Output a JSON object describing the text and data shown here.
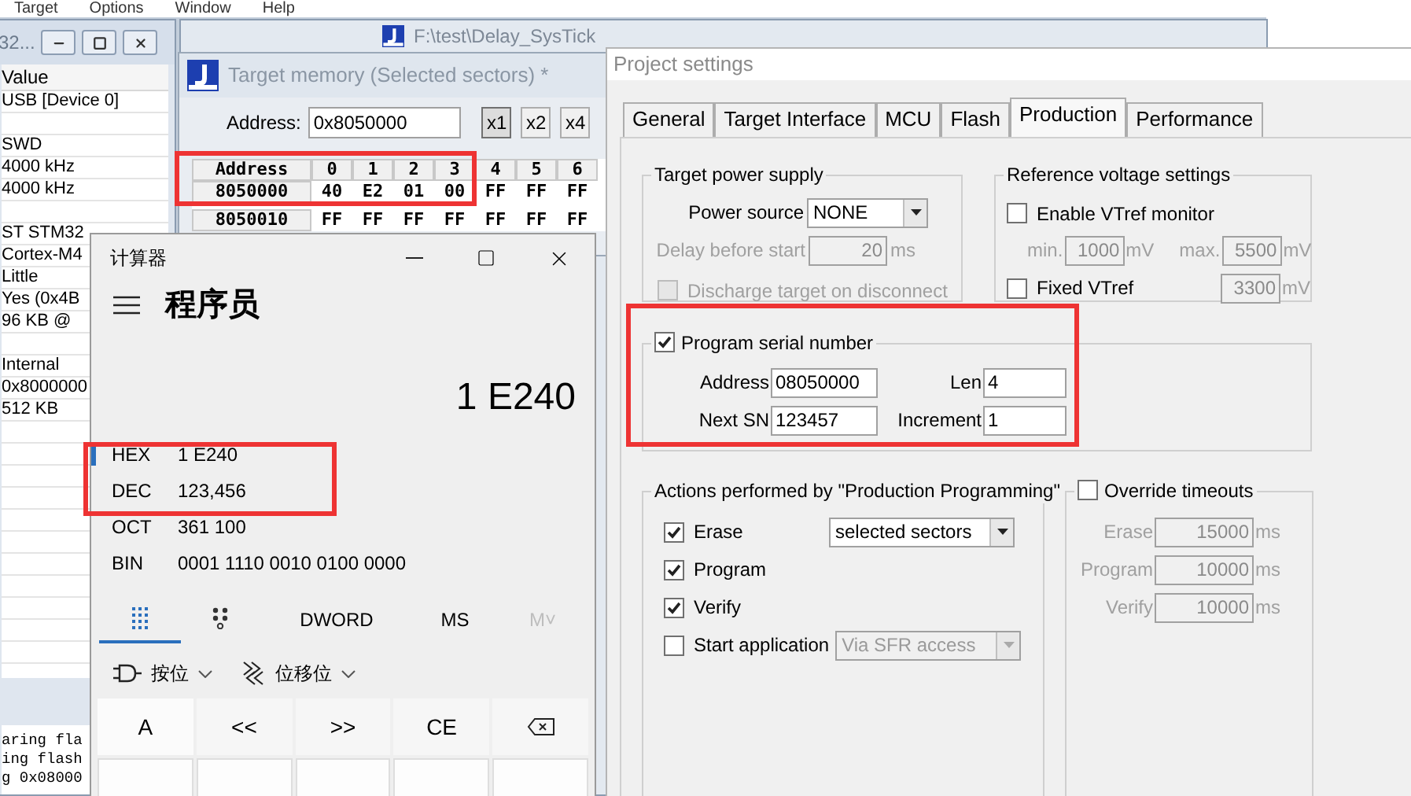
{
  "menu_bar": [
    "Target",
    "Options",
    "Window",
    "Help"
  ],
  "left_window": {
    "title": "32...",
    "column": "Value",
    "groups": [
      [
        "USB [Device 0]"
      ],
      [
        "SWD",
        "4000 kHz",
        "4000 kHz"
      ],
      [
        "ST STM32",
        "Cortex-M4",
        "Little",
        "Yes (0x4B",
        "96 KB @"
      ],
      [
        "Internal",
        "0x8000000",
        "512 KB"
      ]
    ],
    "log_lines": [
      "aring fla",
      "ing flash",
      "g 0x08000"
    ]
  },
  "project_window": {
    "title": "F:\\test\\Delay_SysTick"
  },
  "memory_window": {
    "title": "Target memory (Selected sectors) *",
    "address_label": "Address:",
    "address": "0x8050000",
    "zoom_buttons": [
      {
        "label": "x1",
        "selected": true
      },
      {
        "label": "x2",
        "selected": false
      },
      {
        "label": "x4",
        "selected": false
      }
    ],
    "columns": [
      "Address",
      "0",
      "1",
      "2",
      "3",
      "4",
      "5",
      "6"
    ],
    "rows": [
      {
        "address": "8050000",
        "bytes": [
          "40",
          "E2",
          "01",
          "00",
          "FF",
          "FF",
          "FF"
        ]
      },
      {
        "address": "8050010",
        "bytes": [
          "FF",
          "FF",
          "FF",
          "FF",
          "FF",
          "FF",
          "FF"
        ]
      }
    ]
  },
  "calculator": {
    "title": "计算器",
    "mode": "程序员",
    "display": "1 E240",
    "radixes": [
      {
        "label": "HEX",
        "value": "1 E240",
        "selected": true
      },
      {
        "label": "DEC",
        "value": "123,456",
        "selected": false
      },
      {
        "label": "OCT",
        "value": "361 100",
        "selected": false
      },
      {
        "label": "BIN",
        "value": "0001 1110 0010 0100 0000",
        "selected": false
      }
    ],
    "keypad_tabs": [
      {
        "kind": "keypad",
        "selected": true
      },
      {
        "kind": "bits",
        "selected": false
      }
    ],
    "word_size": "DWORD",
    "memory_buttons": [
      {
        "label": "MS",
        "disabled": false
      },
      {
        "label": "M˅",
        "disabled": true
      }
    ],
    "menus": [
      {
        "kind": "bitwise",
        "label": "按位"
      },
      {
        "kind": "shift",
        "label": "位移位"
      }
    ],
    "keys": [
      {
        "kind": "text",
        "label": "A"
      },
      {
        "kind": "text",
        "label": "<<"
      },
      {
        "kind": "text",
        "label": ">>"
      },
      {
        "kind": "text",
        "label": "CE"
      },
      {
        "kind": "backspace"
      }
    ]
  },
  "settings": {
    "title": "Project settings",
    "tabs": [
      {
        "label": "General",
        "selected": false
      },
      {
        "label": "Target Interface",
        "selected": false
      },
      {
        "label": "MCU",
        "selected": false
      },
      {
        "label": "Flash",
        "selected": false
      },
      {
        "label": "Production",
        "selected": true
      },
      {
        "label": "Performance",
        "selected": false
      }
    ],
    "power_supply": {
      "title": "Target power supply",
      "source_label": "Power source",
      "source": "NONE",
      "delay_label": "Delay before start",
      "delay": "20",
      "delay_unit": "ms",
      "delay_disabled": true,
      "discharge": {
        "label": "Discharge target on disconnect",
        "checked": false,
        "disabled": true
      }
    },
    "reference": {
      "title": "Reference voltage settings",
      "enable": {
        "label": "Enable VTref monitor",
        "checked": false
      },
      "min_label": "min.",
      "min": "1000",
      "min_unit": "mV",
      "max_label": "max.",
      "max": "5500",
      "max_unit": "mV",
      "range_disabled": true,
      "fixed": {
        "label": "Fixed VTref",
        "checked": false
      },
      "fixed_value": "3300",
      "fixed_unit": "mV",
      "fixed_disabled": true
    },
    "serial": {
      "label": "Program serial number",
      "checked": true,
      "fields": [
        {
          "label": "Address",
          "value": "08050000"
        },
        {
          "label": "Len",
          "value": "4"
        },
        {
          "label": "Next SN",
          "value": "123457"
        },
        {
          "label": "Increment",
          "value": "1"
        }
      ]
    },
    "actions": {
      "title": "Actions performed by \"Production Programming\"",
      "items": [
        {
          "label": "Erase",
          "checked": true,
          "dropdown": {
            "value": "selected sectors",
            "disabled": false
          }
        },
        {
          "label": "Program",
          "checked": true
        },
        {
          "label": "Verify",
          "checked": true
        },
        {
          "label": "Start application",
          "checked": false,
          "dropdown": {
            "value": "Via SFR access",
            "disabled": true
          }
        }
      ]
    },
    "timeouts": {
      "label": "Override timeouts",
      "checked": false,
      "fields": [
        {
          "label": "Erase",
          "value": "15000",
          "unit": "ms",
          "disabled": true
        },
        {
          "label": "Program",
          "value": "10000",
          "unit": "ms",
          "disabled": true
        },
        {
          "label": "Verify",
          "value": "10000",
          "unit": "ms",
          "disabled": true
        }
      ]
    }
  }
}
